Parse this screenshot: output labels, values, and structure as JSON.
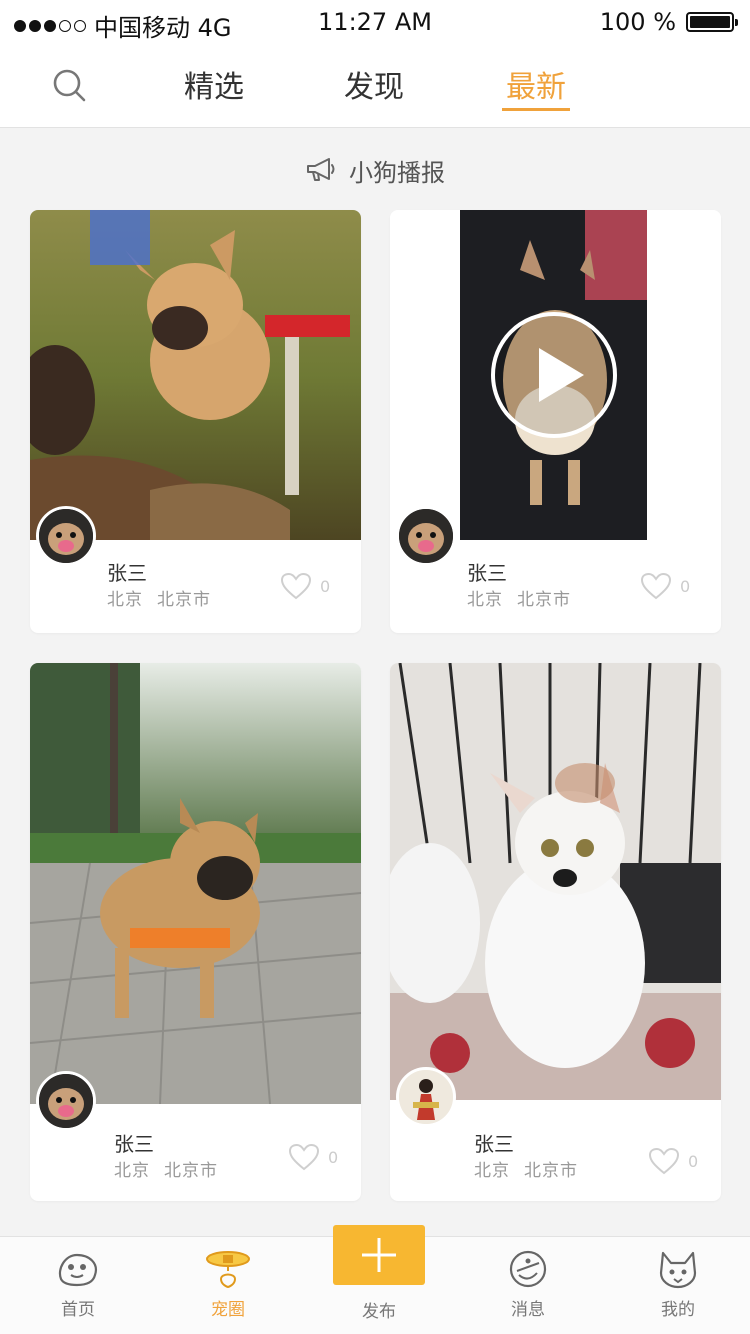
{
  "status_bar": {
    "carrier": "中国移动 4G",
    "time": "11:27 AM",
    "battery": "100 %"
  },
  "top_nav": {
    "tabs": [
      {
        "label": "精选"
      },
      {
        "label": "发现"
      },
      {
        "label": "最新"
      }
    ],
    "active_tab": "最新",
    "accent_color": "#f0a23b"
  },
  "announcement": {
    "label": "小狗播报"
  },
  "posts": [
    {
      "name": "张三",
      "province": "北京",
      "city": "北京市",
      "likes": "0",
      "is_video": false
    },
    {
      "name": "张三",
      "province": "北京",
      "city": "北京市",
      "likes": "0",
      "is_video": true
    },
    {
      "name": "张三",
      "province": "北京",
      "city": "北京市",
      "likes": "0",
      "is_video": false
    },
    {
      "name": "张三",
      "province": "北京",
      "city": "北京市",
      "likes": "0",
      "is_video": false
    }
  ],
  "bottom_bar": {
    "items": [
      {
        "label": "首页",
        "icon": "home-icon"
      },
      {
        "label": "宠圈",
        "icon": "collar-icon"
      },
      {
        "label": "发布",
        "icon": "plus-icon"
      },
      {
        "label": "消息",
        "icon": "message-icon"
      },
      {
        "label": "我的",
        "icon": "dog-face-icon"
      }
    ],
    "active": "宠圈",
    "publish_color": "#f7b731"
  }
}
